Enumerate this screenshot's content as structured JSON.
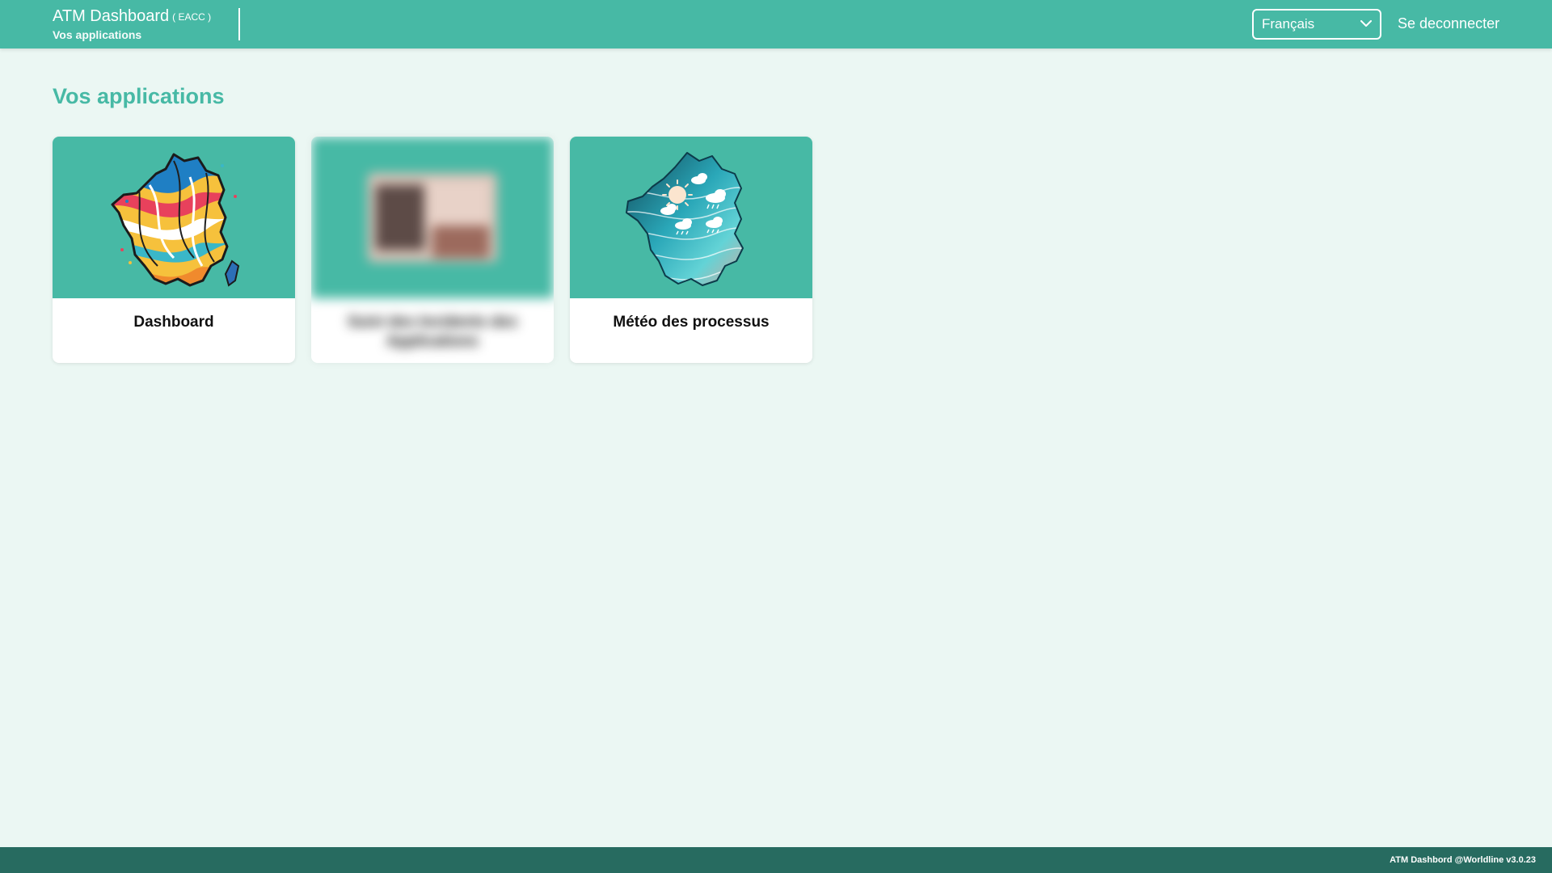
{
  "header": {
    "app_title": "ATM Dashboard",
    "env_tag": "( EACC )",
    "subtitle": "Vos applications",
    "language": {
      "selected": "Français"
    },
    "logout_label": "Se deconnecter"
  },
  "main": {
    "title": "Vos applications",
    "cards": [
      {
        "label": "Dashboard",
        "icon": "france-map-colorful-icon"
      },
      {
        "label": "Suivi des Incidents des Applications",
        "icon": "blurred-image"
      },
      {
        "label": "Météo des processus",
        "icon": "france-weather-map-icon"
      }
    ]
  },
  "footer": {
    "text": "ATM Dashbord @Worldline v3.0.23"
  },
  "colors": {
    "primary": "#47b9a5",
    "background": "#ebf7f3",
    "footer": "#276b60",
    "title_accent": "#47b9a5"
  }
}
